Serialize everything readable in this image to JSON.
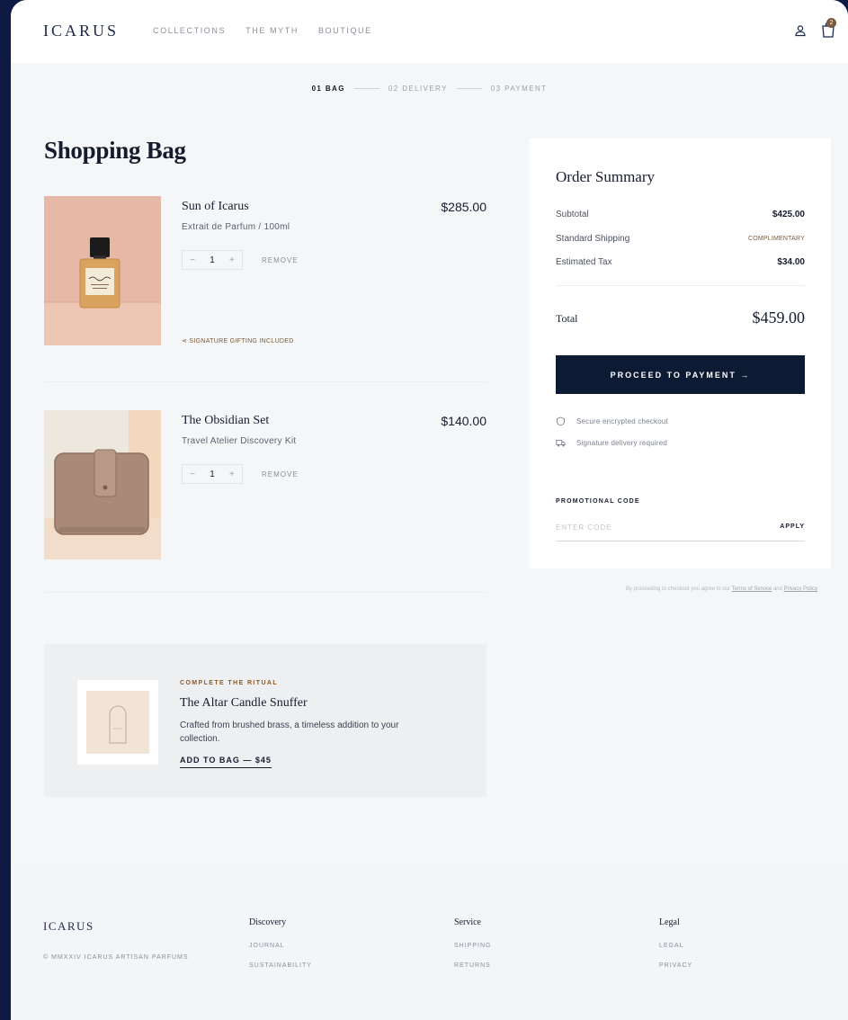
{
  "header": {
    "logo": "ICARUS",
    "nav": [
      "COLLECTIONS",
      "THE MYTH",
      "BOUTIQUE"
    ],
    "bag_count": "2"
  },
  "steps": [
    {
      "label": "01 BAG",
      "active": true
    },
    {
      "label": "02 DELIVERY",
      "active": false
    },
    {
      "label": "03 PAYMENT",
      "active": false
    }
  ],
  "page_title": "Shopping Bag",
  "items": [
    {
      "name": "Sun of Icarus",
      "description": "Extrait de Parfum / 100ml",
      "price": "$285.00",
      "quantity": "1",
      "remove_label": "REMOVE",
      "note": "SIGNATURE GIFTING INCLUDED",
      "image_colors": {
        "background": "#e6b9a6",
        "bottle": "#d9a25e"
      }
    },
    {
      "name": "The Obsidian Set",
      "description": "Travel Atelier Discovery Kit",
      "price": "$140.00",
      "quantity": "1",
      "remove_label": "REMOVE",
      "image_colors": {
        "background": "#ede7de",
        "case": "#a98a78"
      }
    }
  ],
  "ritual": {
    "tag": "COMPLETE THE RITUAL",
    "title": "The Altar Candle Snuffer",
    "description": "Crafted from brushed brass, a timeless addition to your collection.",
    "cta": "ADD TO BAG — $45"
  },
  "summary": {
    "title": "Order Summary",
    "rows": [
      {
        "label": "Subtotal",
        "value": "$425.00"
      },
      {
        "label": "Standard Shipping",
        "value": "COMPLIMENTARY"
      },
      {
        "label": "Estimated Tax",
        "value": "$34.00"
      }
    ],
    "total_label": "Total",
    "total_value": "$459.00",
    "pay_button": "PROCEED TO PAYMENT →",
    "assurances": [
      "Secure encrypted checkout",
      "Signature delivery required"
    ],
    "promo_label": "PROMOTIONAL CODE",
    "promo_placeholder": "ENTER CODE",
    "promo_apply": "APPLY",
    "terms_prefix": "By proceeding to checkout you agree to our",
    "terms_link": "Terms of Service",
    "terms_and": "and",
    "privacy_link": "Privacy Policy"
  },
  "footer": {
    "logo": "ICARUS",
    "copyright": "© MMXXIV ICARUS ARTISAN PARFUMS",
    "columns": [
      {
        "heading": "Discovery",
        "links": [
          "JOURNAL",
          "SUSTAINABILITY"
        ]
      },
      {
        "heading": "Service",
        "links": [
          "SHIPPING",
          "RETURNS"
        ]
      },
      {
        "heading": "Legal",
        "links": [
          "LEGAL",
          "PRIVACY"
        ]
      }
    ]
  },
  "colors": {
    "accent": "#0d1a33",
    "brand_brown": "#7a5a3a",
    "outer_background": "#0e1a44"
  }
}
